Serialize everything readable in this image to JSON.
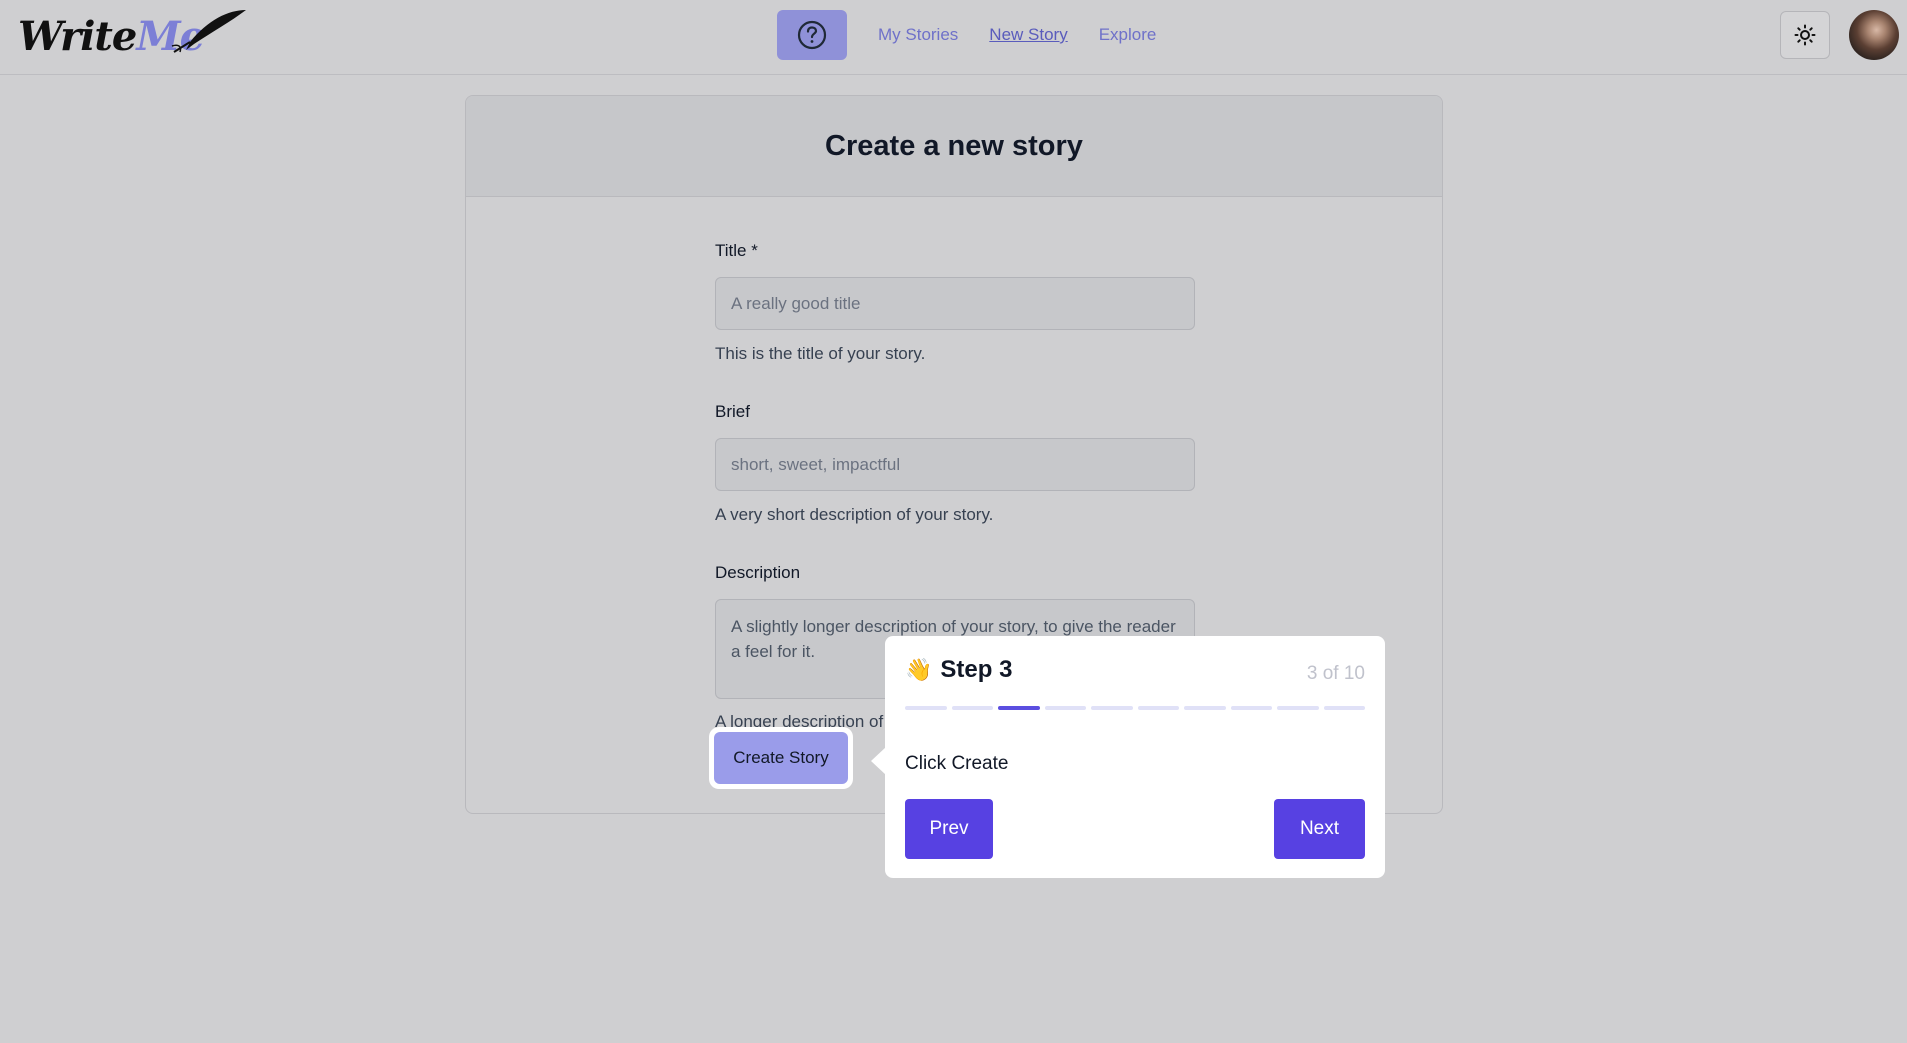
{
  "app": {
    "logo_main": "Write",
    "logo_accent": "Me"
  },
  "nav": {
    "items": [
      {
        "label": "My Stories"
      },
      {
        "label": "New Story"
      },
      {
        "label": "Explore"
      }
    ],
    "active_item": "New Story"
  },
  "icons": {
    "help": "help-circle-icon",
    "theme": "sun-icon",
    "logo": "quill-feather-icon",
    "avatar": "user-avatar"
  },
  "page": {
    "title": "Create a new story"
  },
  "form": {
    "title_label": "Title *",
    "title_placeholder": "A really good title",
    "title_help": "This is the title of your story.",
    "brief_label": "Brief",
    "brief_placeholder": "short, sweet, impactful",
    "brief_help": "A very short description of your story.",
    "description_label": "Description",
    "description_placeholder": "A slightly longer description of your story, to give the reader a feel for it.",
    "description_help": "A longer description of",
    "submit_label": "Create Story"
  },
  "tour": {
    "emoji": "👋",
    "title": "Step 3",
    "counter": "3 of 10",
    "current_step": 3,
    "total_steps": 10,
    "body": "Click Create",
    "prev_label": "Prev",
    "next_label": "Next"
  },
  "colors": {
    "accent": "#5741e2",
    "nav_link": "#6f71c9",
    "create_button": "#9a9cea",
    "background": "#cfcfd1"
  }
}
